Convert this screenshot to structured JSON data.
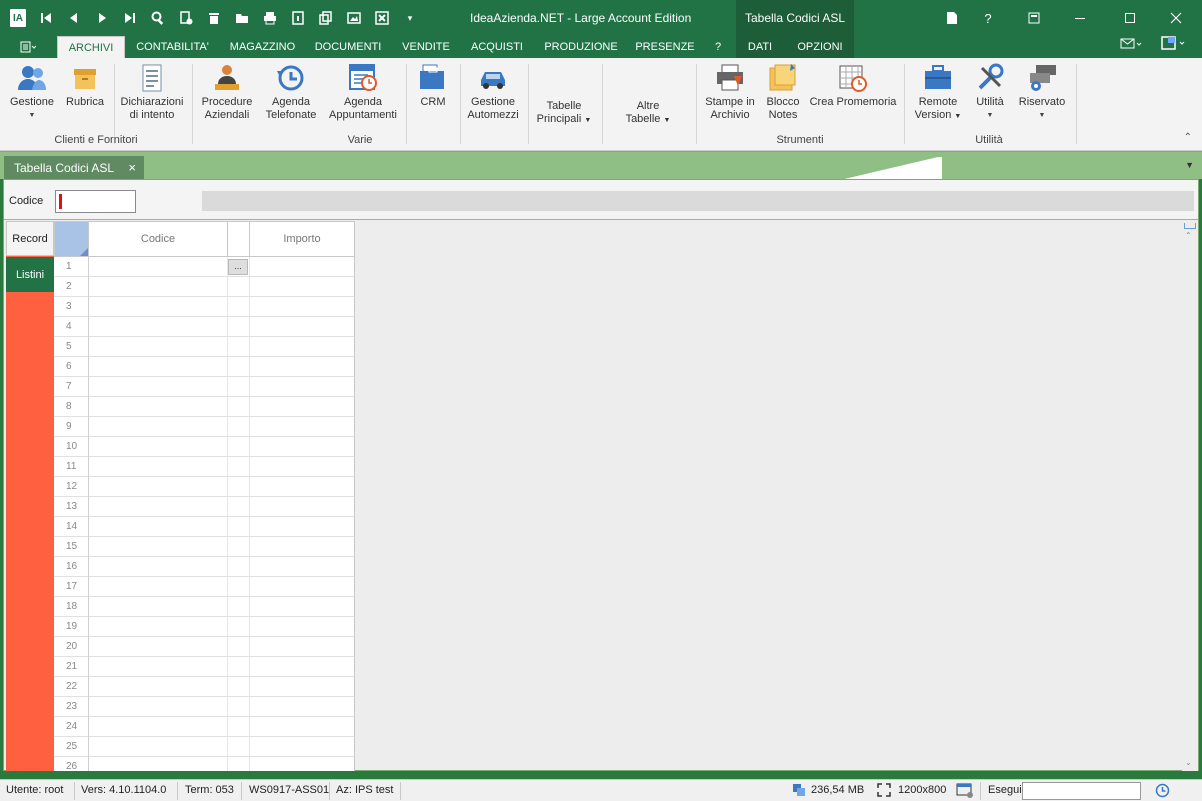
{
  "window": {
    "title": "IdeaAzienda.NET - Large Account Edition",
    "context_tab_title": "Tabella Codici ASL",
    "help": "?",
    "logo_text": "IA"
  },
  "ribbon_tabs": [
    {
      "label": "ARCHIVI",
      "active": true
    },
    {
      "label": "CONTABILITA'"
    },
    {
      "label": "MAGAZZINO"
    },
    {
      "label": "DOCUMENTI"
    },
    {
      "label": "VENDITE"
    },
    {
      "label": "ACQUISTI"
    },
    {
      "label": "PRODUZIONE"
    },
    {
      "label": "PRESENZE"
    },
    {
      "label": "?"
    },
    {
      "label": "DATI"
    },
    {
      "label": "OPZIONI"
    }
  ],
  "ribbon": {
    "buttons": {
      "gestione": "Gestione",
      "rubrica": "Rubrica",
      "dichiarazioni": [
        "Dichiarazioni",
        "di intento"
      ],
      "procedure": [
        "Procedure",
        "Aziendali"
      ],
      "agenda_tel": [
        "Agenda",
        "Telefonate"
      ],
      "agenda_app": [
        "Agenda",
        "Appuntamenti"
      ],
      "crm": "CRM",
      "automezzi": [
        "Gestione",
        "Automezzi"
      ],
      "tabelle_principali": [
        "Tabelle",
        "Principali"
      ],
      "altre_tabelle": [
        "Altre",
        "Tabelle"
      ],
      "stampe": [
        "Stampe in",
        "Archivio"
      ],
      "blocco": [
        "Blocco",
        "Notes"
      ],
      "crea_promemoria": "Crea Promemoria",
      "remote": [
        "Remote",
        "Version"
      ],
      "utilita": "Utilità",
      "riservato": "Riservato"
    },
    "groups": {
      "clienti": "Clienti e Fornitori",
      "varie": "Varie",
      "strumenti": "Strumenti",
      "utilita": "Utilità"
    }
  },
  "document_tab": {
    "label": "Tabella Codici ASL",
    "close": "×"
  },
  "header": {
    "codice_label": "Codice",
    "codice_value": ""
  },
  "side_buttons": {
    "record": "Record",
    "listini": "Listini"
  },
  "grid": {
    "columns": [
      "Codice",
      "",
      "Importo"
    ],
    "rows": [
      "1",
      "2",
      "3",
      "4",
      "5",
      "6",
      "7",
      "8",
      "9",
      "10",
      "11",
      "12",
      "13",
      "14",
      "15",
      "16",
      "17",
      "18",
      "19",
      "20",
      "21",
      "22",
      "23",
      "24",
      "25",
      "26"
    ],
    "ellipsis": "..."
  },
  "status": {
    "utente": "Utente: root",
    "versione": "Vers: 4.10.1104.0",
    "terminale": "Term: 053",
    "workstation": "WS0917-ASS01",
    "azienda": "Az: IPS test",
    "memoria": "236,54 MB",
    "risoluzione": "1200x800",
    "esegui": "Esegui"
  },
  "colors": {
    "brand_green": "#217346",
    "strip_green": "#8fbf85",
    "side_orange": "#ff6040"
  }
}
